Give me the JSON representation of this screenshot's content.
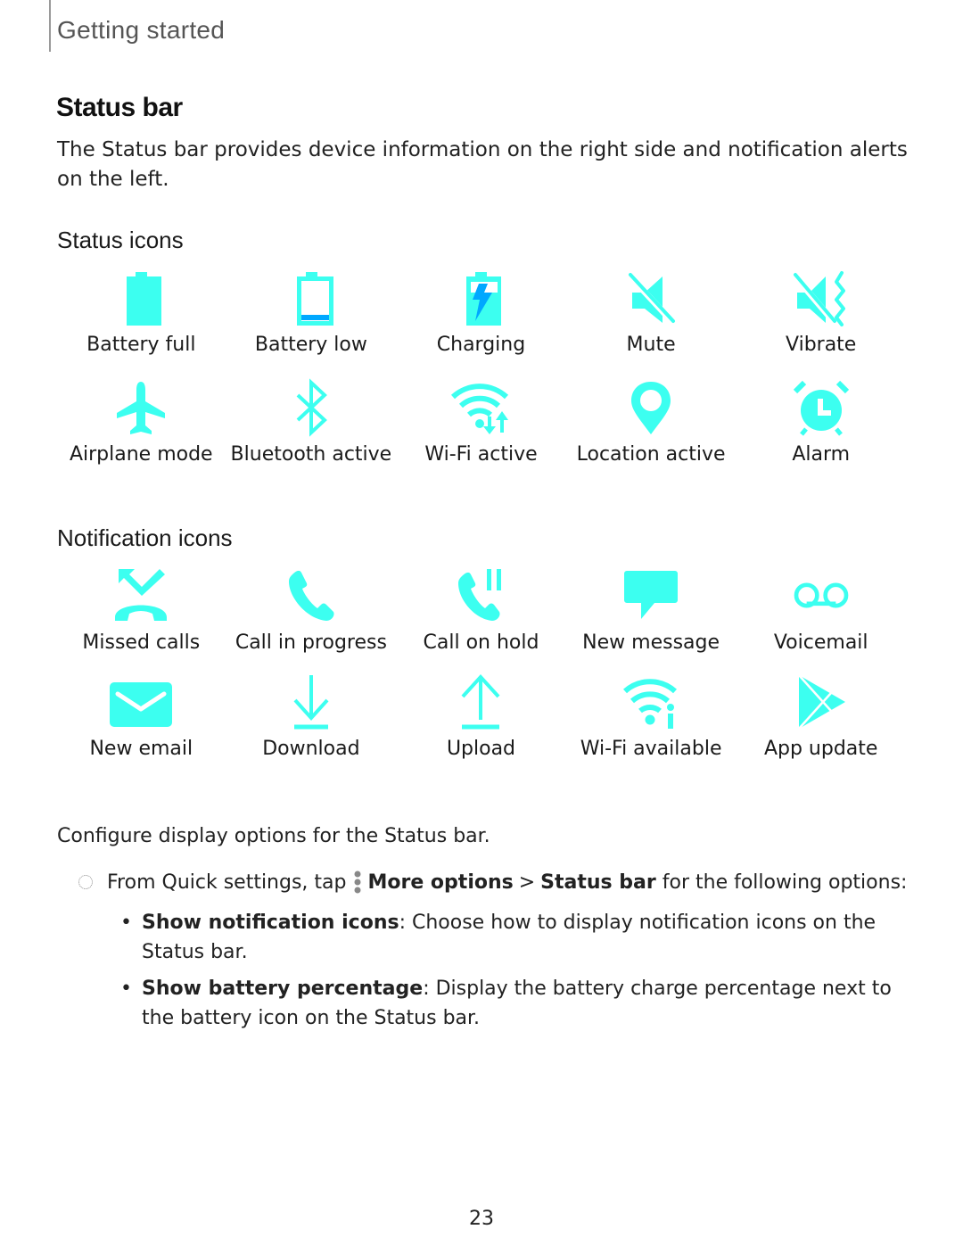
{
  "header": {
    "section": "Getting started"
  },
  "page": {
    "title": "Status bar",
    "intro": "The Status bar provides device information on the right side and notification alerts on the left.",
    "number": "23"
  },
  "colors": {
    "icon_primary": "#3cfff0",
    "icon_accent": "#00a8ff"
  },
  "status_icons": {
    "heading": "Status icons",
    "items": [
      {
        "label": "Battery full",
        "icon": "battery-full-icon"
      },
      {
        "label": "Battery low",
        "icon": "battery-low-icon"
      },
      {
        "label": "Charging",
        "icon": "battery-charging-icon"
      },
      {
        "label": "Mute",
        "icon": "mute-icon"
      },
      {
        "label": "Vibrate",
        "icon": "vibrate-icon"
      },
      {
        "label": "Airplane mode",
        "icon": "airplane-icon"
      },
      {
        "label": "Bluetooth active",
        "icon": "bluetooth-icon"
      },
      {
        "label": "Wi-Fi active",
        "icon": "wifi-active-icon"
      },
      {
        "label": "Location active",
        "icon": "location-pin-icon"
      },
      {
        "label": "Alarm",
        "icon": "alarm-clock-icon"
      }
    ]
  },
  "notification_icons": {
    "heading": "Notification icons",
    "items": [
      {
        "label": "Missed calls",
        "icon": "missed-call-icon"
      },
      {
        "label": "Call in progress",
        "icon": "phone-icon"
      },
      {
        "label": "Call on hold",
        "icon": "call-hold-icon"
      },
      {
        "label": "New message",
        "icon": "message-bubble-icon"
      },
      {
        "label": "Voicemail",
        "icon": "voicemail-icon"
      },
      {
        "label": "New email",
        "icon": "envelope-icon"
      },
      {
        "label": "Download",
        "icon": "download-icon"
      },
      {
        "label": "Upload",
        "icon": "upload-icon"
      },
      {
        "label": "Wi-Fi available",
        "icon": "wifi-available-icon"
      },
      {
        "label": "App update",
        "icon": "play-store-icon"
      }
    ]
  },
  "configure": {
    "text": "Configure display options for the Status bar.",
    "step": {
      "prefix": "From Quick settings, tap",
      "more_options": "More options",
      "separator": ">",
      "status_bar": "Status bar",
      "suffix": "for the following options:"
    },
    "options": [
      {
        "name": "Show notification icons",
        "description": ": Choose how to display notification icons on the Status bar."
      },
      {
        "name": "Show battery percentage",
        "description": ": Display the battery charge percentage next to the battery icon on the Status bar."
      }
    ]
  }
}
